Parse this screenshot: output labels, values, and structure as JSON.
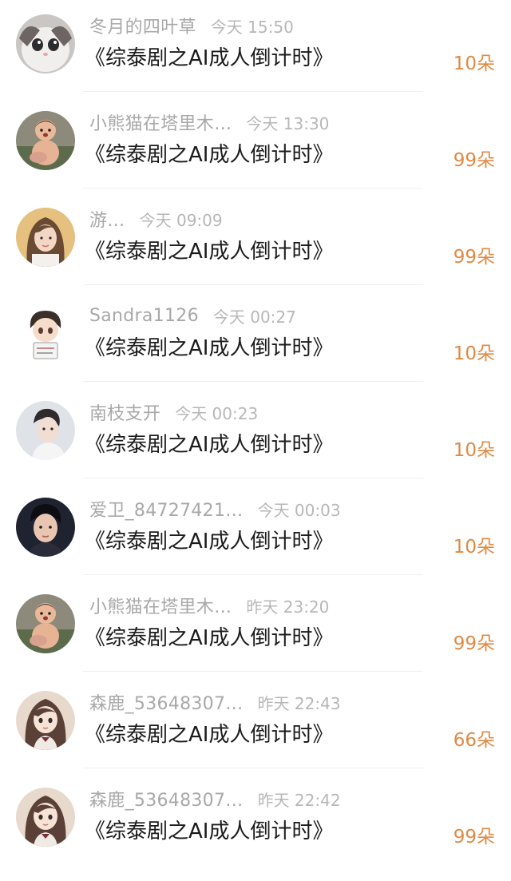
{
  "messages": [
    {
      "name": "冬月的四叶草",
      "time": "今天 15:50",
      "text": "《综泰剧之AI成人倒计时》",
      "gift": "10朵",
      "avatar": "cat-avatar-icon"
    },
    {
      "name": "小熊猫在塔里木…",
      "time": "今天 13:30",
      "text": "《综泰剧之AI成人倒计时》",
      "gift": "99朵",
      "avatar": "baby-avatar-icon"
    },
    {
      "name": "游…",
      "time": "今天 09:09",
      "text": "《综泰剧之AI成人倒计时》",
      "gift": "99朵",
      "avatar": "girl-photo-avatar-icon"
    },
    {
      "name": "Sandra1126",
      "time": "今天 00:27",
      "text": "《综泰剧之AI成人倒计时》",
      "gift": "10朵",
      "avatar": "cartoon-boy-avatar-icon"
    },
    {
      "name": "南枝支开",
      "time": "今天 00:23",
      "text": "《综泰剧之AI成人倒计时》",
      "gift": "10朵",
      "avatar": "man-photo-avatar-icon"
    },
    {
      "name": "爱卫_84727421…",
      "time": "今天 00:03",
      "text": "《综泰剧之AI成人倒计时》",
      "gift": "10朵",
      "avatar": "dark-portrait-avatar-icon"
    },
    {
      "name": "小熊猫在塔里木…",
      "time": "昨天 23:20",
      "text": "《综泰剧之AI成人倒计时》",
      "gift": "99朵",
      "avatar": "baby-avatar-icon"
    },
    {
      "name": "森鹿_53648307…",
      "time": "昨天 22:43",
      "text": "《综泰剧之AI成人倒计时》",
      "gift": "66朵",
      "avatar": "anime-girl-avatar-icon"
    },
    {
      "name": "森鹿_53648307…",
      "time": "昨天 22:42",
      "text": "《综泰剧之AI成人倒计时》",
      "gift": "99朵",
      "avatar": "anime-girl-avatar-icon"
    }
  ],
  "colors": {
    "name": "#a8a8a8",
    "time": "#b7b7b7",
    "text": "#1b1b1b",
    "gift": "#e08a45"
  }
}
